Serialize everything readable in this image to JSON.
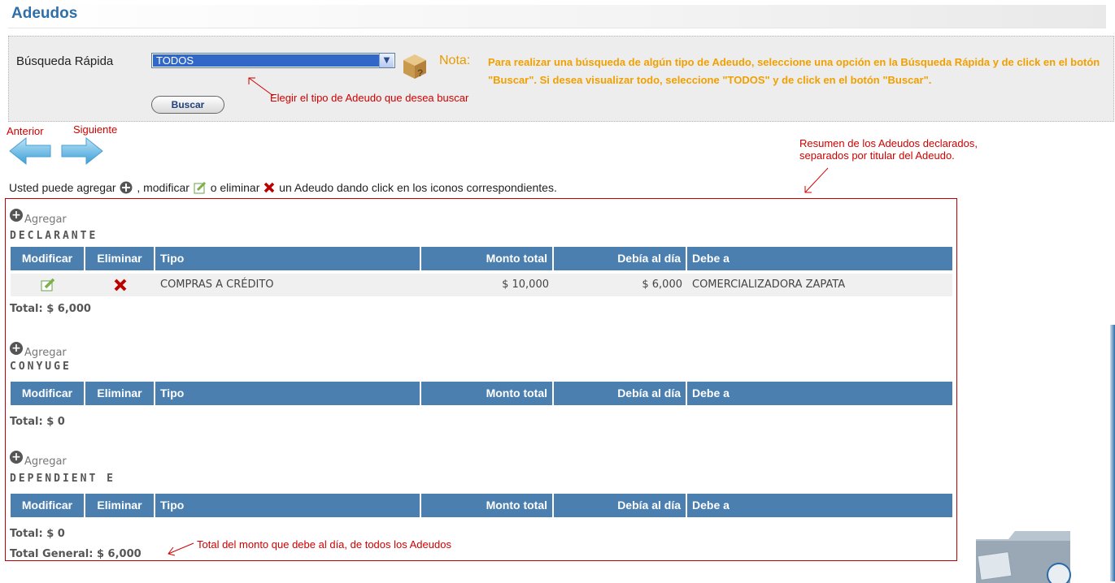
{
  "page": {
    "title": "Adeudos"
  },
  "search": {
    "label": "Búsqueda Rápida",
    "selected": "TODOS",
    "button": "Buscar",
    "nota_label": "Nota:",
    "nota_text": "Para realizar una búsqueda de algún tipo de Adeudo, seleccione una opción en la Búsqueda Rápida y de click en el botón \"Buscar\". Si desea visualizar todo, seleccione \"TODOS\" y de click en el botón \"Buscar\"."
  },
  "annotations": {
    "select_hint": "Elegir el tipo de Adeudo que desea buscar",
    "summary_hint_1": "Resumen de los Adeudos declarados,",
    "summary_hint_2": "separados por titular del Adeudo.",
    "total_hint": "Total del monto que debe al día, de todos los Adeudos"
  },
  "nav": {
    "prev": "Anterior",
    "next": "Siguiente"
  },
  "intro": {
    "part1": "Usted puede agregar",
    "part2": ", modificar",
    "part3": " o eliminar",
    "part4": " un Adeudo dando click en los iconos correspondientes."
  },
  "columns": [
    "Modificar",
    "Eliminar",
    "Tipo",
    "Monto total",
    "Debía al día",
    "Debe a"
  ],
  "agregar_label": "Agregar",
  "sections": [
    {
      "title": "DECLARANTE",
      "rows": [
        {
          "tipo": "COMPRAS A CRÉDITO",
          "monto": "$ 10,000",
          "debia": "$ 6,000",
          "debe_a": "COMERCIALIZADORA ZAPATA"
        }
      ],
      "total": "Total: $ 6,000"
    },
    {
      "title": "CONYUGE",
      "rows": [],
      "total": "Total: $ 0"
    },
    {
      "title": "DEPENDIENT E",
      "rows": [],
      "total": "Total: $ 0"
    }
  ],
  "total_general": "Total General: $ 6,000",
  "colors": {
    "accent": "#4a7fb0",
    "title": "#2f6fa8",
    "note": "#f0a000",
    "annotation": "#d00000"
  }
}
